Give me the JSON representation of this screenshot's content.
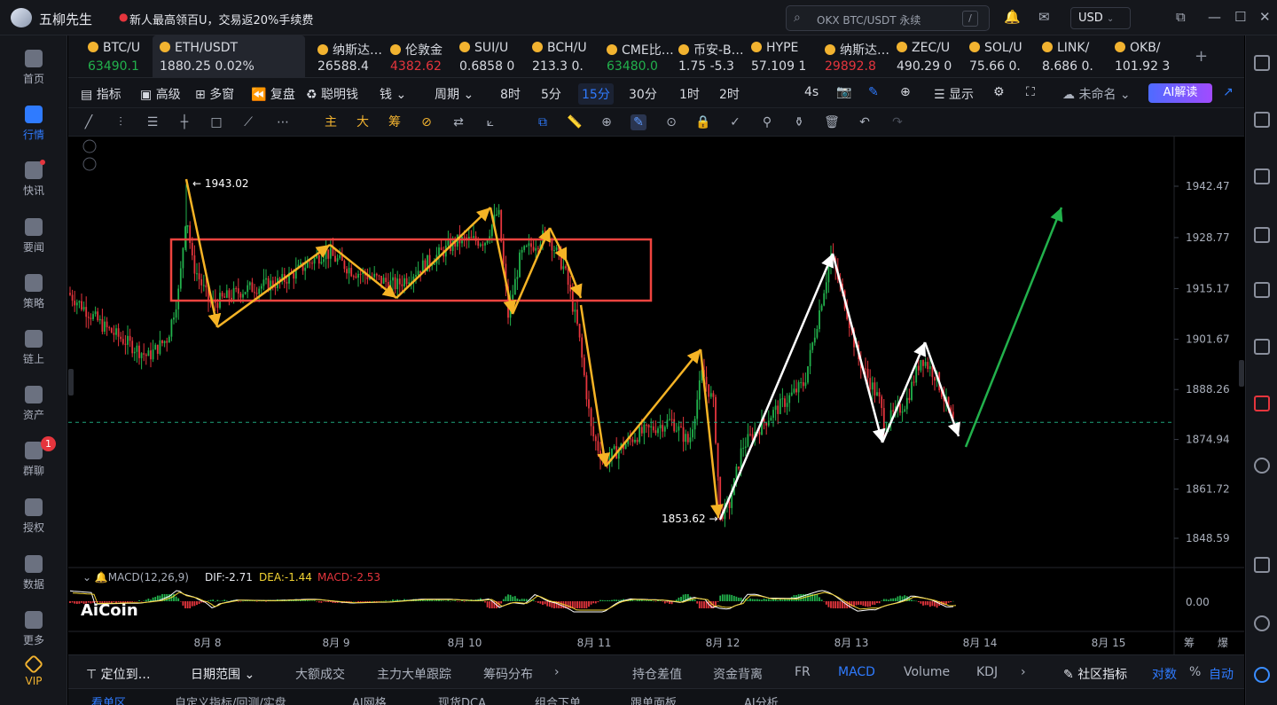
{
  "app": {
    "name": "五柳先生",
    "promo": "新人最高领百U，交易返20%手续费",
    "search_placeholder": "OKX BTC/USDT 永续",
    "search_shortcut": "/",
    "currency": "USD"
  },
  "nav": [
    {
      "label": "首页",
      "icon": "home-icon"
    },
    {
      "label": "行情",
      "icon": "market-icon",
      "active": true
    },
    {
      "label": "快讯",
      "icon": "flash-news-icon",
      "dot": true
    },
    {
      "label": "要闻",
      "icon": "news-icon"
    },
    {
      "label": "策略",
      "icon": "strategy-icon"
    },
    {
      "label": "链上",
      "icon": "onchain-icon"
    },
    {
      "label": "资产",
      "icon": "wallet-icon"
    },
    {
      "label": "群聊",
      "icon": "chat-icon",
      "badge": "1"
    },
    {
      "label": "授权",
      "icon": "key-icon"
    },
    {
      "label": "数据",
      "icon": "data-icon"
    },
    {
      "label": "更多",
      "icon": "more-icon"
    },
    {
      "label": "VIP",
      "icon": "vip-icon"
    }
  ],
  "tickers": [
    {
      "name": "BTC/U",
      "price": "63490.1",
      "trend": "up"
    },
    {
      "name": "ETH/USDT",
      "price": "1880.25 0.02%",
      "trend": "up",
      "active": true
    },
    {
      "name": "纳斯达…",
      "price": "26588.4",
      "trend": "neu"
    },
    {
      "name": "伦敦金",
      "price": "4382.62",
      "trend": "dn"
    },
    {
      "name": "SUI/U",
      "price": "0.6858 0",
      "trend": "neu"
    },
    {
      "name": "BCH/U",
      "price": "213.3 0.",
      "trend": "neu"
    },
    {
      "name": "CME比…",
      "price": "63480.0",
      "trend": "up"
    },
    {
      "name": "币安-B…",
      "price": "1.75 -5.3",
      "trend": "neu"
    },
    {
      "name": "HYPE",
      "price": "57.109 1",
      "trend": "neu"
    },
    {
      "name": "纳斯达…",
      "price": "29892.8",
      "trend": "dn"
    },
    {
      "name": "ZEC/U",
      "price": "490.29 0",
      "trend": "neu"
    },
    {
      "name": "SOL/U",
      "price": "75.66 0.",
      "trend": "neu"
    },
    {
      "name": "LINK/",
      "price": "8.686 0.",
      "trend": "neu"
    },
    {
      "name": "OKB/",
      "price": "101.92 3",
      "trend": "neu"
    }
  ],
  "toolbar": {
    "indicators": "指标",
    "advanced": "高级",
    "multi": "多窗",
    "replay": "复盘",
    "smart_money": "聪明钱",
    "period": "周期",
    "intervals": [
      "8时",
      "5分",
      "15分",
      "30分",
      "1时",
      "2时"
    ],
    "selected_interval": "15分",
    "refresh": "4s",
    "display": "显示",
    "layout_name": "未命名",
    "ai": "AI解读"
  },
  "drawing_tools": {
    "main": "主",
    "big": "大",
    "chips": "筹"
  },
  "chart_data": {
    "type": "candlestick",
    "symbol": "ETH/USDT",
    "interval": "15分",
    "y_ticks": [
      "1942.47",
      "1928.77",
      "1915.17",
      "1901.67",
      "1888.26",
      "1874.94",
      "1861.72",
      "1848.59"
    ],
    "x_ticks": [
      "8月 8",
      "8月 9",
      "8月 10",
      "8月 11",
      "8月 12",
      "8月 13",
      "8月 14",
      "8月 15"
    ],
    "high_marker": "1943.02",
    "low_marker": "1853.62",
    "last_price": 1879.5,
    "y_range": [
      1845,
      1952
    ],
    "macd": {
      "label": "MACD(12,26,9)",
      "dif": "DIF:-2.71",
      "dea": "DEA:-1.44",
      "macd": "MACD:-2.53",
      "zero": "0.00"
    },
    "watermark": "AiCoin"
  },
  "bottom_tabs": {
    "locate": "定位到…",
    "date_range": "日期范围",
    "items": [
      "大额成交",
      "主力大单跟踪",
      "筹码分布"
    ],
    "right": [
      "持仓差值",
      "资金背离",
      "FR",
      "MACD",
      "Volume",
      "KDJ"
    ],
    "community": "社区指标",
    "log": "对数",
    "pct": "%",
    "auto": "自动",
    "corner": [
      "筹",
      "爆"
    ]
  },
  "bottom_panel_tabs": [
    "看单区",
    "自定义指标/回测/实盘",
    "AI网格",
    "现货DCA",
    "组合下单",
    "跟单面板",
    "AI分析"
  ]
}
